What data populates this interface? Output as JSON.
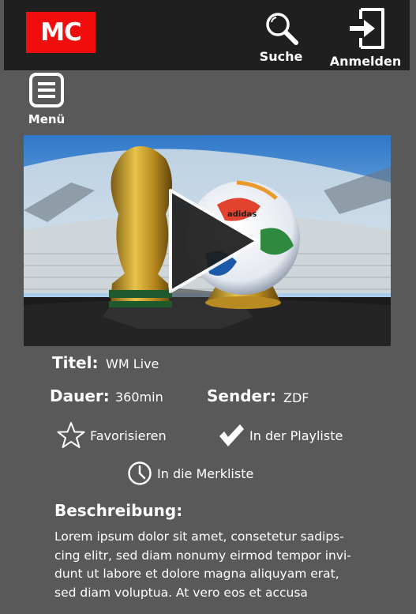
{
  "header": {
    "logo_text": "MC",
    "search_label": "Suche",
    "login_label": "Anmelden",
    "menu_label": "Menü"
  },
  "hero": {
    "image_description": "World Cup trophy and football in stadium",
    "play_icon": "play-icon"
  },
  "details": {
    "title_label": "Titel:",
    "title_value": "WM Live",
    "duration_label": "Dauer:",
    "duration_value": "360min",
    "channel_label": "Sender:",
    "channel_value": "ZDF"
  },
  "actions": {
    "favorite": "Favorisieren",
    "playlist": "In der Playliste",
    "watchlist": "In die Merkliste"
  },
  "description": {
    "title": "Beschreibung:",
    "lines": [
      "Lorem ipsum dolor sit amet, consetetur sadips-",
      "cing elitr, sed diam nonumy eirmod tempor invi-",
      "dunt ut labore et dolore magna aliquyam erat,",
      "sed diam voluptua. At vero eos et accusa"
    ]
  },
  "colors": {
    "background": "#595959",
    "topbar": "#1f1f1f",
    "logo": "#f20d0d"
  }
}
